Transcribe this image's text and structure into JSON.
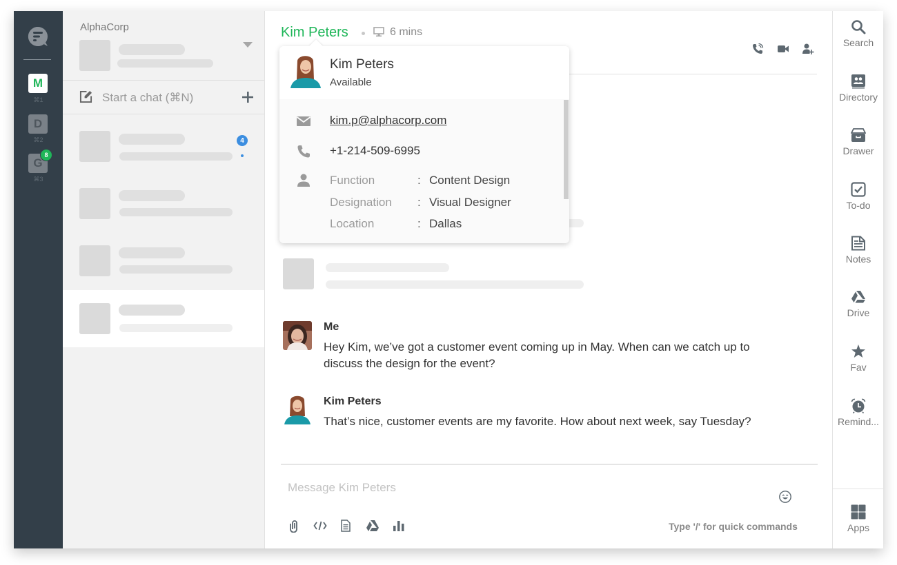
{
  "workspaces": [
    {
      "letter": "M",
      "shortcut": "⌘1",
      "active": true
    },
    {
      "letter": "D",
      "shortcut": "⌘2",
      "active": false
    },
    {
      "letter": "G",
      "shortcut": "⌘3",
      "active": false,
      "badge": "8"
    }
  ],
  "sidebar": {
    "org_name": "AlphaCorp",
    "start_chat_label": "Start a chat (⌘N)",
    "unread_count": "4"
  },
  "chat_header": {
    "contact_name": "Kim Peters",
    "device_icon": "monitor-icon",
    "last_seen": "6 mins",
    "actions": [
      "voice-call-icon",
      "video-call-icon",
      "add-user-icon"
    ]
  },
  "profile_popover": {
    "name": "Kim Peters",
    "status": "Available",
    "email": "kim.p@alphacorp.com",
    "phone": "+1-214-509-6995",
    "fields": [
      {
        "label": "Function",
        "value": "Content Design"
      },
      {
        "label": "Designation",
        "value": "Visual Designer"
      },
      {
        "label": "Location",
        "value": "Dallas"
      }
    ]
  },
  "messages": [
    {
      "sender": "Me",
      "text": "Hey Kim, we’ve got a customer event coming up in May. When can we catch up to discuss the design for the event?"
    },
    {
      "sender": "Kim Peters",
      "text": "That’s nice, customer events are my favorite. How about next week, say Tuesday?"
    }
  ],
  "composer": {
    "placeholder": "Message Kim Peters",
    "hint": "Type '/' for quick commands",
    "tools": [
      "attachment-icon",
      "code-icon",
      "document-icon",
      "drive-icon",
      "poll-icon"
    ]
  },
  "right_rail": [
    {
      "label": "Search",
      "icon": "search-icon"
    },
    {
      "label": "Directory",
      "icon": "directory-icon"
    },
    {
      "label": "Drawer",
      "icon": "drawer-icon"
    },
    {
      "label": "To-do",
      "icon": "todo-icon"
    },
    {
      "label": "Notes",
      "icon": "notes-icon"
    },
    {
      "label": "Drive",
      "icon": "drive-icon"
    },
    {
      "label": "Fav",
      "icon": "star-icon"
    },
    {
      "label": "Remind...",
      "icon": "alarm-clock-icon"
    },
    {
      "label": "Apps",
      "icon": "apps-grid-icon"
    }
  ],
  "colors": {
    "brand_green": "#1fb659",
    "rail_dark": "#333f49",
    "unread_blue": "#3c8ee0",
    "icon_gray": "#5d6870"
  }
}
